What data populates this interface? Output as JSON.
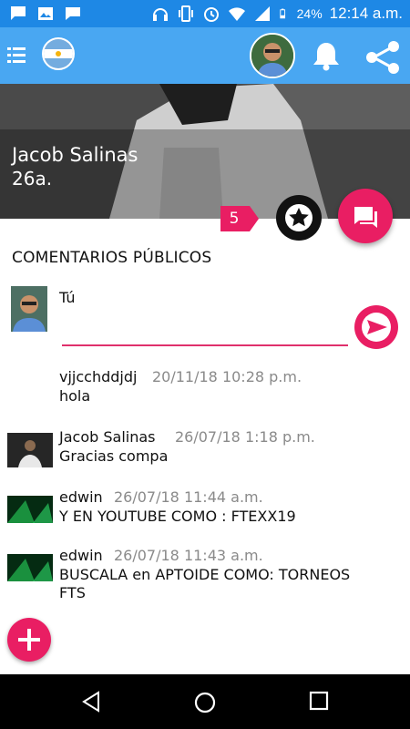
{
  "status_bar": {
    "battery": "24%",
    "time": "12:14 a.m.",
    "icons": [
      "message-icon",
      "image-icon",
      "chat-icon",
      "headphones-icon",
      "vibrate-icon",
      "alarm-icon",
      "wifi-icon",
      "signal-icon",
      "battery-icon"
    ]
  },
  "app_bar": {
    "icons": [
      "menu-icon",
      "argentina-flag",
      "profile-avatar",
      "bell-icon",
      "share-icon"
    ],
    "color": "#49a7f2"
  },
  "profile": {
    "name": "Jacob Salinas",
    "age": "26a.",
    "star_count": "5"
  },
  "comments_section": {
    "title": "COMENTARIOS PÚBLICOS",
    "composer_label": "Tú",
    "composer_value": ""
  },
  "comments": [
    {
      "author": "vjjcchddjdj",
      "date": "20/11/18 10:28 p.m.",
      "text": "hola",
      "avatar": "none"
    },
    {
      "author": "Jacob Salinas",
      "date": "26/07/18 1:18 p.m.",
      "text": "Gracias compa",
      "avatar": "photo"
    },
    {
      "author": "edwin",
      "date": "26/07/18 11:44 a.m.",
      "text": "Y EN YOUTUBE COMO : FTEXX19",
      "avatar": "green-photo"
    },
    {
      "author": "edwin",
      "date": "26/07/18 11:43 a.m.",
      "text": "BUSCALA en APTOIDE COMO: TORNEOS FTS",
      "avatar": "green-photo"
    }
  ],
  "accent_color": "#e91e63"
}
